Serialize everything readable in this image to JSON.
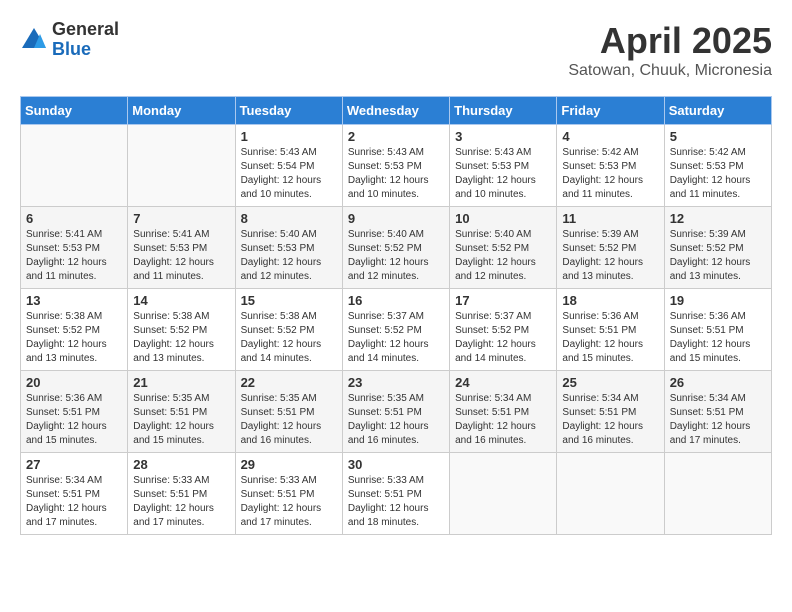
{
  "header": {
    "logo_general": "General",
    "logo_blue": "Blue",
    "title": "April 2025",
    "location": "Satowan, Chuuk, Micronesia"
  },
  "weekdays": [
    "Sunday",
    "Monday",
    "Tuesday",
    "Wednesday",
    "Thursday",
    "Friday",
    "Saturday"
  ],
  "weeks": [
    [
      {
        "day": "",
        "detail": ""
      },
      {
        "day": "",
        "detail": ""
      },
      {
        "day": "1",
        "detail": "Sunrise: 5:43 AM\nSunset: 5:54 PM\nDaylight: 12 hours\nand 10 minutes."
      },
      {
        "day": "2",
        "detail": "Sunrise: 5:43 AM\nSunset: 5:53 PM\nDaylight: 12 hours\nand 10 minutes."
      },
      {
        "day": "3",
        "detail": "Sunrise: 5:43 AM\nSunset: 5:53 PM\nDaylight: 12 hours\nand 10 minutes."
      },
      {
        "day": "4",
        "detail": "Sunrise: 5:42 AM\nSunset: 5:53 PM\nDaylight: 12 hours\nand 11 minutes."
      },
      {
        "day": "5",
        "detail": "Sunrise: 5:42 AM\nSunset: 5:53 PM\nDaylight: 12 hours\nand 11 minutes."
      }
    ],
    [
      {
        "day": "6",
        "detail": "Sunrise: 5:41 AM\nSunset: 5:53 PM\nDaylight: 12 hours\nand 11 minutes."
      },
      {
        "day": "7",
        "detail": "Sunrise: 5:41 AM\nSunset: 5:53 PM\nDaylight: 12 hours\nand 11 minutes."
      },
      {
        "day": "8",
        "detail": "Sunrise: 5:40 AM\nSunset: 5:53 PM\nDaylight: 12 hours\nand 12 minutes."
      },
      {
        "day": "9",
        "detail": "Sunrise: 5:40 AM\nSunset: 5:52 PM\nDaylight: 12 hours\nand 12 minutes."
      },
      {
        "day": "10",
        "detail": "Sunrise: 5:40 AM\nSunset: 5:52 PM\nDaylight: 12 hours\nand 12 minutes."
      },
      {
        "day": "11",
        "detail": "Sunrise: 5:39 AM\nSunset: 5:52 PM\nDaylight: 12 hours\nand 13 minutes."
      },
      {
        "day": "12",
        "detail": "Sunrise: 5:39 AM\nSunset: 5:52 PM\nDaylight: 12 hours\nand 13 minutes."
      }
    ],
    [
      {
        "day": "13",
        "detail": "Sunrise: 5:38 AM\nSunset: 5:52 PM\nDaylight: 12 hours\nand 13 minutes."
      },
      {
        "day": "14",
        "detail": "Sunrise: 5:38 AM\nSunset: 5:52 PM\nDaylight: 12 hours\nand 13 minutes."
      },
      {
        "day": "15",
        "detail": "Sunrise: 5:38 AM\nSunset: 5:52 PM\nDaylight: 12 hours\nand 14 minutes."
      },
      {
        "day": "16",
        "detail": "Sunrise: 5:37 AM\nSunset: 5:52 PM\nDaylight: 12 hours\nand 14 minutes."
      },
      {
        "day": "17",
        "detail": "Sunrise: 5:37 AM\nSunset: 5:52 PM\nDaylight: 12 hours\nand 14 minutes."
      },
      {
        "day": "18",
        "detail": "Sunrise: 5:36 AM\nSunset: 5:51 PM\nDaylight: 12 hours\nand 15 minutes."
      },
      {
        "day": "19",
        "detail": "Sunrise: 5:36 AM\nSunset: 5:51 PM\nDaylight: 12 hours\nand 15 minutes."
      }
    ],
    [
      {
        "day": "20",
        "detail": "Sunrise: 5:36 AM\nSunset: 5:51 PM\nDaylight: 12 hours\nand 15 minutes."
      },
      {
        "day": "21",
        "detail": "Sunrise: 5:35 AM\nSunset: 5:51 PM\nDaylight: 12 hours\nand 15 minutes."
      },
      {
        "day": "22",
        "detail": "Sunrise: 5:35 AM\nSunset: 5:51 PM\nDaylight: 12 hours\nand 16 minutes."
      },
      {
        "day": "23",
        "detail": "Sunrise: 5:35 AM\nSunset: 5:51 PM\nDaylight: 12 hours\nand 16 minutes."
      },
      {
        "day": "24",
        "detail": "Sunrise: 5:34 AM\nSunset: 5:51 PM\nDaylight: 12 hours\nand 16 minutes."
      },
      {
        "day": "25",
        "detail": "Sunrise: 5:34 AM\nSunset: 5:51 PM\nDaylight: 12 hours\nand 16 minutes."
      },
      {
        "day": "26",
        "detail": "Sunrise: 5:34 AM\nSunset: 5:51 PM\nDaylight: 12 hours\nand 17 minutes."
      }
    ],
    [
      {
        "day": "27",
        "detail": "Sunrise: 5:34 AM\nSunset: 5:51 PM\nDaylight: 12 hours\nand 17 minutes."
      },
      {
        "day": "28",
        "detail": "Sunrise: 5:33 AM\nSunset: 5:51 PM\nDaylight: 12 hours\nand 17 minutes."
      },
      {
        "day": "29",
        "detail": "Sunrise: 5:33 AM\nSunset: 5:51 PM\nDaylight: 12 hours\nand 17 minutes."
      },
      {
        "day": "30",
        "detail": "Sunrise: 5:33 AM\nSunset: 5:51 PM\nDaylight: 12 hours\nand 18 minutes."
      },
      {
        "day": "",
        "detail": ""
      },
      {
        "day": "",
        "detail": ""
      },
      {
        "day": "",
        "detail": ""
      }
    ]
  ]
}
